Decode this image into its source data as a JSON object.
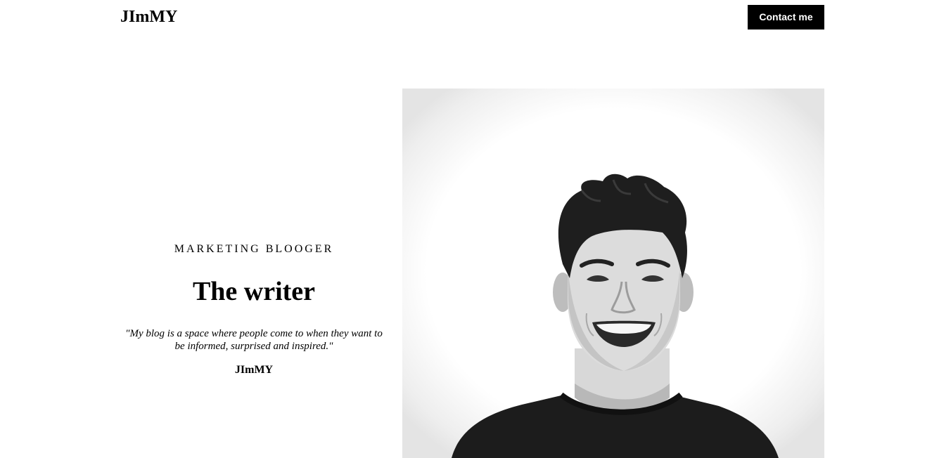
{
  "header": {
    "logo": "JImMY",
    "contact_label": "Contact me"
  },
  "hero": {
    "subtitle": "MARKETING BLOOGER",
    "title": "The writer",
    "quote": "\"My blog is a space where people come to when they want to be informed, surprised and inspired.\"",
    "author": "JImMY"
  },
  "photo": {
    "description_icon": "portrait-photo",
    "style": "black-and-white"
  }
}
